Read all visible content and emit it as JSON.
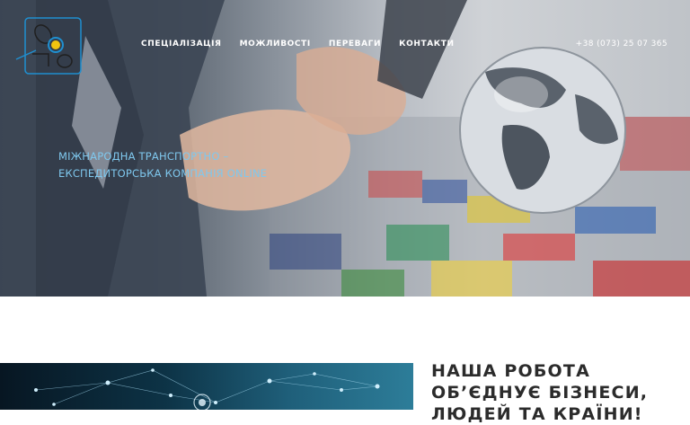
{
  "brand": {
    "logo_icon": "company-logo-icon"
  },
  "nav": {
    "items": [
      {
        "label": "СПЕЦІАЛІЗАЦІЯ"
      },
      {
        "label": "МОЖЛИВОСТІ"
      },
      {
        "label": "ПЕРЕВАГИ"
      },
      {
        "label": "КОНТАКТИ"
      }
    ],
    "phone": "+38 (073) 25 07 365"
  },
  "hero": {
    "tagline_line1": "МІЖНАРОДНА ТРАНСПОРТНО –",
    "tagline_line2": "ЕКСПЕДИТОРСЬКА КОМПАНІЯ ONLINE",
    "image": "handshake-globe-flags-photo"
  },
  "section": {
    "headline_line1": "НАША РОБОТА",
    "headline_line2": "ОБ’ЄДНУЄ БІЗНЕСИ,",
    "headline_line3": "ЛЮДЕЙ ТА КРАЇНИ!",
    "image": "network-connections-photo"
  },
  "colors": {
    "tagline": "#7fc8ee",
    "headline": "#2b2b2b",
    "logo": "#1f8fd0"
  }
}
